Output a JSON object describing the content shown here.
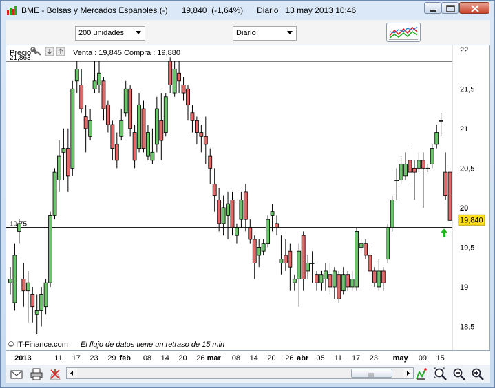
{
  "window": {
    "title": "BME - Bolsas y Mercados Espanoles (-)      19,840  (-1,64%)      Diario   13 may 2013 10:46"
  },
  "toolbar": {
    "units_dropdown": "200 unidades",
    "period_dropdown": "Diario",
    "indicator_icon": "indicator-chart-icon"
  },
  "chart_header": {
    "label": "Precio",
    "quote": "Venta : 19,845  Compra : 19,880"
  },
  "footer_notes": {
    "copyright": "© IT-Finance.com",
    "delay_notice": "El flujo de datos tiene un retraso de 15 min"
  },
  "colors": {
    "up": "#6cc36c",
    "down": "#e06a6a",
    "price_label_bg": "#ffe01a",
    "arrow_up": "#1eb81e"
  },
  "chart_data": {
    "type": "candlestick",
    "y_ticks": [
      "22",
      "21,5",
      "21",
      "20,5",
      "20",
      "19,5",
      "19",
      "18,5"
    ],
    "y_tick_values": [
      22,
      21.5,
      21,
      20.5,
      20,
      19.5,
      19,
      18.5
    ],
    "ylim": [
      18.2,
      22.05
    ],
    "hlines": [
      {
        "value": 21.85,
        "label": "21,863"
      },
      {
        "value": 19.75,
        "label": "19,75"
      }
    ],
    "last_price": {
      "value": 19.84,
      "label": "19,840"
    },
    "x_labels": [
      {
        "text": "2013",
        "bold": true,
        "index": 3
      },
      {
        "text": "11",
        "bold": false,
        "index": 11
      },
      {
        "text": "17",
        "bold": false,
        "index": 15
      },
      {
        "text": "23",
        "bold": false,
        "index": 19
      },
      {
        "text": "29",
        "bold": false,
        "index": 23
      },
      {
        "text": "feb",
        "bold": true,
        "index": 26
      },
      {
        "text": "08",
        "bold": false,
        "index": 31
      },
      {
        "text": "14",
        "bold": false,
        "index": 35
      },
      {
        "text": "20",
        "bold": false,
        "index": 39
      },
      {
        "text": "26",
        "bold": false,
        "index": 43
      },
      {
        "text": "mar",
        "bold": true,
        "index": 46
      },
      {
        "text": "08",
        "bold": false,
        "index": 51
      },
      {
        "text": "14",
        "bold": false,
        "index": 55
      },
      {
        "text": "20",
        "bold": false,
        "index": 59
      },
      {
        "text": "26",
        "bold": false,
        "index": 63
      },
      {
        "text": "abr",
        "bold": true,
        "index": 66
      },
      {
        "text": "05",
        "bold": false,
        "index": 70
      },
      {
        "text": "11",
        "bold": false,
        "index": 74
      },
      {
        "text": "17",
        "bold": false,
        "index": 78
      },
      {
        "text": "23",
        "bold": false,
        "index": 82
      },
      {
        "text": "may",
        "bold": true,
        "index": 88
      },
      {
        "text": "09",
        "bold": false,
        "index": 93
      },
      {
        "text": "15",
        "bold": false,
        "index": 97
      }
    ],
    "candles": [
      {
        "o": 19.05,
        "h": 19.25,
        "l": 18.9,
        "c": 19.1
      },
      {
        "o": 18.8,
        "h": 19.55,
        "l": 18.7,
        "c": 19.4
      },
      {
        "o": 19.7,
        "h": 19.85,
        "l": 19.55,
        "c": 19.8
      },
      {
        "o": 19.1,
        "h": 19.3,
        "l": 18.75,
        "c": 18.95
      },
      {
        "o": 18.95,
        "h": 19.2,
        "l": 18.55,
        "c": 19.05
      },
      {
        "o": 18.9,
        "h": 19.0,
        "l": 18.55,
        "c": 18.75
      },
      {
        "o": 18.65,
        "h": 18.9,
        "l": 18.4,
        "c": 18.7
      },
      {
        "o": 18.7,
        "h": 19.0,
        "l": 18.5,
        "c": 18.9
      },
      {
        "o": 18.75,
        "h": 19.1,
        "l": 18.65,
        "c": 19.05
      },
      {
        "o": 19.05,
        "h": 19.95,
        "l": 19.0,
        "c": 19.9
      },
      {
        "o": 19.9,
        "h": 20.5,
        "l": 19.85,
        "c": 20.45
      },
      {
        "o": 20.35,
        "h": 20.85,
        "l": 20.2,
        "c": 20.65
      },
      {
        "o": 20.7,
        "h": 21.0,
        "l": 20.35,
        "c": 20.75
      },
      {
        "o": 20.75,
        "h": 21.0,
        "l": 20.2,
        "c": 20.4
      },
      {
        "o": 20.5,
        "h": 21.6,
        "l": 20.4,
        "c": 21.5
      },
      {
        "o": 21.6,
        "h": 21.85,
        "l": 21.45,
        "c": 21.75
      },
      {
        "o": 21.55,
        "h": 21.75,
        "l": 21.2,
        "c": 21.25
      },
      {
        "o": 21.15,
        "h": 21.3,
        "l": 20.7,
        "c": 21.0
      },
      {
        "o": 20.9,
        "h": 21.25,
        "l": 20.85,
        "c": 21.1
      },
      {
        "o": 21.5,
        "h": 21.85,
        "l": 21.45,
        "c": 21.6
      },
      {
        "o": 21.55,
        "h": 21.85,
        "l": 21.45,
        "c": 21.7
      },
      {
        "o": 21.6,
        "h": 21.65,
        "l": 21.1,
        "c": 21.25
      },
      {
        "o": 21.3,
        "h": 21.35,
        "l": 20.95,
        "c": 21.05
      },
      {
        "o": 21.05,
        "h": 21.1,
        "l": 20.6,
        "c": 20.75
      },
      {
        "o": 20.8,
        "h": 20.95,
        "l": 20.5,
        "c": 20.6
      },
      {
        "o": 20.9,
        "h": 21.25,
        "l": 20.85,
        "c": 21.1
      },
      {
        "o": 21.2,
        "h": 21.6,
        "l": 21.15,
        "c": 21.5
      },
      {
        "o": 21.5,
        "h": 21.55,
        "l": 20.9,
        "c": 21.0
      },
      {
        "o": 20.95,
        "h": 21.05,
        "l": 20.5,
        "c": 20.6
      },
      {
        "o": 20.75,
        "h": 21.45,
        "l": 20.7,
        "c": 21.3
      },
      {
        "o": 21.25,
        "h": 21.35,
        "l": 20.7,
        "c": 20.75
      },
      {
        "o": 20.65,
        "h": 21.05,
        "l": 20.6,
        "c": 20.95
      },
      {
        "o": 20.6,
        "h": 21.0,
        "l": 20.55,
        "c": 20.7
      },
      {
        "o": 20.8,
        "h": 21.4,
        "l": 20.7,
        "c": 21.25
      },
      {
        "o": 21.1,
        "h": 21.45,
        "l": 20.6,
        "c": 20.85
      },
      {
        "o": 20.95,
        "h": 21.45,
        "l": 20.9,
        "c": 21.4
      },
      {
        "o": 21.85,
        "h": 21.9,
        "l": 21.45,
        "c": 21.55
      },
      {
        "o": 21.45,
        "h": 21.85,
        "l": 21.4,
        "c": 21.75
      },
      {
        "o": 21.7,
        "h": 21.85,
        "l": 21.45,
        "c": 21.6
      },
      {
        "o": 21.55,
        "h": 21.65,
        "l": 21.35,
        "c": 21.45
      },
      {
        "o": 21.5,
        "h": 21.55,
        "l": 21.1,
        "c": 21.3
      },
      {
        "o": 21.2,
        "h": 21.3,
        "l": 20.95,
        "c": 21.1
      },
      {
        "o": 21.1,
        "h": 21.15,
        "l": 20.8,
        "c": 20.95
      },
      {
        "o": 20.95,
        "h": 21.05,
        "l": 20.7,
        "c": 20.9
      },
      {
        "o": 20.9,
        "h": 21.15,
        "l": 20.55,
        "c": 20.8
      },
      {
        "o": 20.65,
        "h": 20.75,
        "l": 20.3,
        "c": 20.5
      },
      {
        "o": 20.3,
        "h": 20.5,
        "l": 19.95,
        "c": 20.15
      },
      {
        "o": 20.1,
        "h": 20.25,
        "l": 19.7,
        "c": 19.8
      },
      {
        "o": 19.8,
        "h": 20.15,
        "l": 19.65,
        "c": 20.0
      },
      {
        "o": 19.9,
        "h": 20.2,
        "l": 19.6,
        "c": 20.05
      },
      {
        "o": 20.1,
        "h": 20.2,
        "l": 19.65,
        "c": 19.75
      },
      {
        "o": 19.65,
        "h": 19.8,
        "l": 19.55,
        "c": 19.75
      },
      {
        "o": 19.85,
        "h": 20.2,
        "l": 19.75,
        "c": 20.1
      },
      {
        "o": 20.2,
        "h": 20.3,
        "l": 19.7,
        "c": 19.85
      },
      {
        "o": 19.75,
        "h": 19.85,
        "l": 19.55,
        "c": 19.6
      },
      {
        "o": 19.6,
        "h": 19.65,
        "l": 19.1,
        "c": 19.3
      },
      {
        "o": 19.4,
        "h": 19.6,
        "l": 19.25,
        "c": 19.5
      },
      {
        "o": 19.45,
        "h": 19.6,
        "l": 19.4,
        "c": 19.55
      },
      {
        "o": 19.55,
        "h": 19.9,
        "l": 19.5,
        "c": 19.85
      },
      {
        "o": 19.9,
        "h": 20.05,
        "l": 19.7,
        "c": 19.95
      },
      {
        "o": 19.8,
        "h": 19.9,
        "l": 19.65,
        "c": 19.75
      },
      {
        "o": 19.3,
        "h": 19.65,
        "l": 19.15,
        "c": 19.35
      },
      {
        "o": 19.4,
        "h": 19.6,
        "l": 19.2,
        "c": 19.3
      },
      {
        "o": 19.45,
        "h": 19.55,
        "l": 18.95,
        "c": 19.25
      },
      {
        "o": 19.05,
        "h": 19.15,
        "l": 18.95,
        "c": 19.1
      },
      {
        "o": 19.1,
        "h": 19.55,
        "l": 18.75,
        "c": 19.45
      },
      {
        "o": 19.65,
        "h": 19.7,
        "l": 18.95,
        "c": 19.1
      },
      {
        "o": 19.2,
        "h": 19.4,
        "l": 19.1,
        "c": 19.3
      },
      {
        "o": 19.3,
        "h": 19.45,
        "l": 19.05,
        "c": 19.3
      },
      {
        "o": 19.15,
        "h": 19.2,
        "l": 18.95,
        "c": 19.05
      },
      {
        "o": 19.05,
        "h": 19.2,
        "l": 18.95,
        "c": 19.15
      },
      {
        "o": 19.1,
        "h": 19.3,
        "l": 18.95,
        "c": 19.2
      },
      {
        "o": 19.15,
        "h": 19.3,
        "l": 18.9,
        "c": 19.0
      },
      {
        "o": 19.0,
        "h": 19.25,
        "l": 18.85,
        "c": 19.2
      },
      {
        "o": 19.15,
        "h": 19.2,
        "l": 18.8,
        "c": 18.85
      },
      {
        "o": 18.95,
        "h": 19.25,
        "l": 18.9,
        "c": 19.15
      },
      {
        "o": 19.15,
        "h": 19.2,
        "l": 18.95,
        "c": 19.0
      },
      {
        "o": 19.0,
        "h": 19.2,
        "l": 18.95,
        "c": 19.1
      },
      {
        "o": 19.0,
        "h": 19.75,
        "l": 18.95,
        "c": 19.7
      },
      {
        "o": 19.5,
        "h": 19.6,
        "l": 19.45,
        "c": 19.55
      },
      {
        "o": 19.55,
        "h": 19.6,
        "l": 19.35,
        "c": 19.4
      },
      {
        "o": 19.4,
        "h": 19.5,
        "l": 19.15,
        "c": 19.2
      },
      {
        "o": 19.2,
        "h": 19.25,
        "l": 19.0,
        "c": 19.05
      },
      {
        "o": 19.0,
        "h": 19.35,
        "l": 18.95,
        "c": 19.2
      },
      {
        "o": 19.2,
        "h": 19.25,
        "l": 18.95,
        "c": 19.05
      },
      {
        "o": 19.35,
        "h": 19.8,
        "l": 19.3,
        "c": 19.75
      },
      {
        "o": 19.75,
        "h": 20.15,
        "l": 19.7,
        "c": 20.1
      },
      {
        "o": 20.35,
        "h": 20.5,
        "l": 20.1,
        "c": 20.35
      },
      {
        "o": 20.35,
        "h": 20.65,
        "l": 20.3,
        "c": 20.55
      },
      {
        "o": 20.4,
        "h": 20.7,
        "l": 20.35,
        "c": 20.55
      },
      {
        "o": 20.6,
        "h": 20.75,
        "l": 20.3,
        "c": 20.45
      },
      {
        "o": 20.5,
        "h": 20.6,
        "l": 20.1,
        "c": 20.45
      },
      {
        "o": 20.5,
        "h": 20.7,
        "l": 20.45,
        "c": 20.6
      },
      {
        "o": 20.6,
        "h": 20.7,
        "l": 20.0,
        "c": 20.5
      },
      {
        "o": 20.5,
        "h": 20.55,
        "l": 20.45,
        "c": 20.5
      },
      {
        "o": 20.55,
        "h": 20.8,
        "l": 20.5,
        "c": 20.75
      },
      {
        "o": 20.8,
        "h": 21.05,
        "l": 20.75,
        "c": 20.95
      },
      {
        "o": 21.1,
        "h": 21.2,
        "l": 20.9,
        "c": 21.1
      },
      {
        "o": 20.45,
        "h": 20.7,
        "l": 20.1,
        "c": 20.15
      },
      {
        "o": 20.45,
        "h": 20.5,
        "l": 19.8,
        "c": 19.84
      }
    ]
  },
  "statusbar": {
    "email": "envelope-icon",
    "print": "printer-icon",
    "clear": "broom-icon",
    "tools": "drawing-tools-icon",
    "zoom_fit": "zoom-fit-icon",
    "zoom_out": "zoom-out-icon",
    "zoom_in": "zoom-in-icon"
  }
}
